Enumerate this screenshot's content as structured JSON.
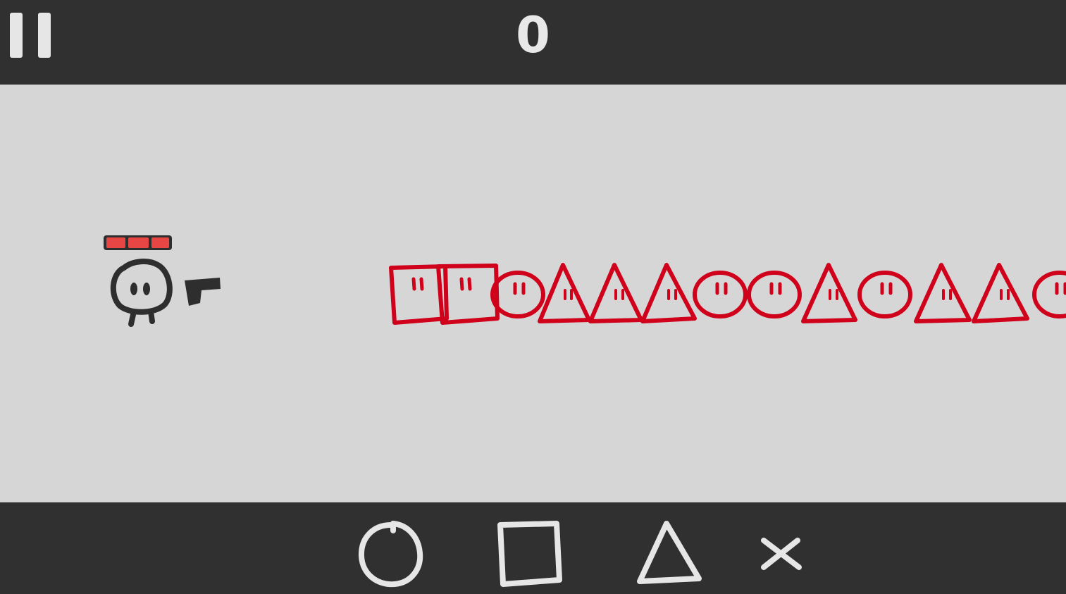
{
  "hud": {
    "score": "0",
    "pause_icon": "pause-icon"
  },
  "player": {
    "health_segments": 3,
    "health_color": "#e84545",
    "weapon_icon": "pistol-icon"
  },
  "enemies": {
    "color": "#d0021b",
    "sequence": [
      "square",
      "square",
      "circle",
      "triangle",
      "triangle",
      "triangle",
      "circle",
      "circle",
      "triangle",
      "circle",
      "triangle",
      "triangle",
      "circle"
    ]
  },
  "controls": [
    {
      "name": "circle",
      "icon": "circle-icon"
    },
    {
      "name": "square",
      "icon": "square-icon"
    },
    {
      "name": "triangle",
      "icon": "triangle-icon"
    },
    {
      "name": "cross",
      "icon": "cross-icon"
    }
  ],
  "colors": {
    "bar_bg": "#303030",
    "play_bg": "#d6d6d6",
    "ink": "#2e2e2e",
    "light_ink": "#e6e6e6"
  }
}
